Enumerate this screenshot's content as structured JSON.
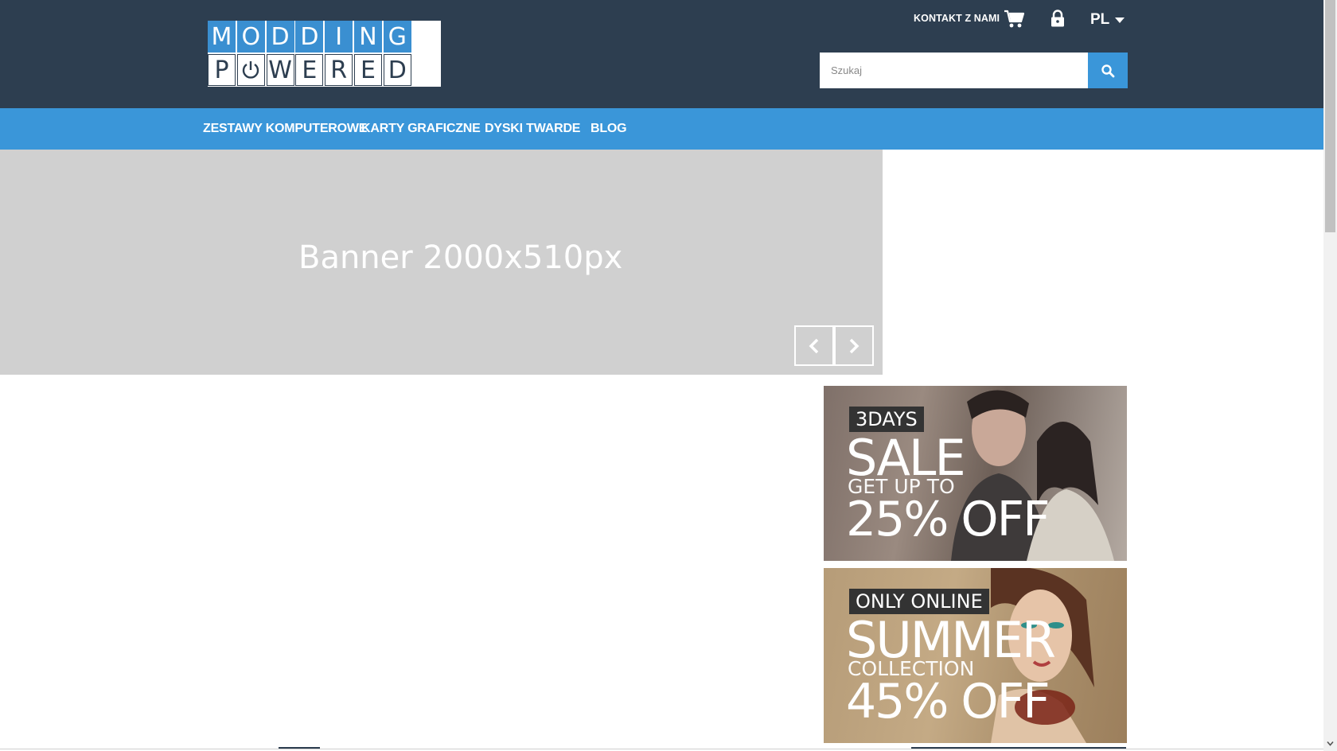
{
  "logo": {
    "top_letters": [
      "M",
      "O",
      "D",
      "D",
      "I",
      "N",
      "G"
    ],
    "bottom_letters": [
      "P",
      "",
      "W",
      "E",
      "R",
      "E",
      "D"
    ],
    "power_icon": "power-icon"
  },
  "topbar": {
    "contact_label": "KONTAKT Z NAMI",
    "cart_icon": "cart-icon",
    "lock_icon": "lock-icon",
    "language": "PL"
  },
  "search": {
    "placeholder": "Szukaj",
    "value": "",
    "icon": "search-icon"
  },
  "nav": {
    "items": [
      {
        "label": "ZESTAWY KOMPUTEROWE"
      },
      {
        "label": "KARTY GRAFICZNE"
      },
      {
        "label": "DYSKI TWARDE"
      },
      {
        "label": "BLOG"
      }
    ]
  },
  "banner": {
    "text": "Banner 2000x510px",
    "prev_icon": "chevron-left-icon",
    "next_icon": "chevron-right-icon"
  },
  "promos": [
    {
      "tag": "3DAYS",
      "headline": "SALE",
      "sub": "GET UP TO",
      "discount": "25% OFF"
    },
    {
      "tag": "ONLY ONLINE",
      "headline": "SUMMER",
      "sub": "COLLECTION",
      "discount": "45% OFF"
    }
  ],
  "colors": {
    "header_bg": "#2d3e50",
    "accent": "#3a96d9",
    "banner_bg": "#d0d0d0"
  }
}
